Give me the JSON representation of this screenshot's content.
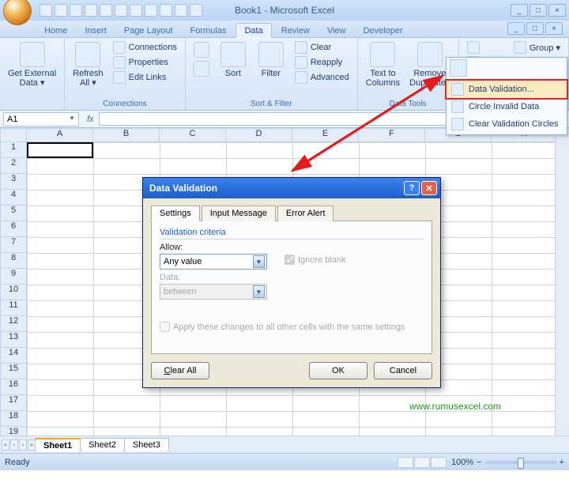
{
  "title": "Book1 - Microsoft Excel",
  "tabs": [
    "Home",
    "Insert",
    "Page Layout",
    "Formulas",
    "Data",
    "Review",
    "View",
    "Developer"
  ],
  "active_tab": "Data",
  "ribbon": {
    "get_external": "Get External\nData ▾",
    "refresh": "Refresh\nAll ▾",
    "connections": "Connections",
    "properties": "Properties",
    "editlinks": "Edit Links",
    "conn_group": "Connections",
    "sort": "Sort",
    "filter": "Filter",
    "clear": "Clear",
    "reapply": "Reapply",
    "advanced": "Advanced",
    "sf_group": "Sort & Filter",
    "ttc": "Text to\nColumns",
    "remdup": "Remove\nDuplicates",
    "dt_group": "Data Tools",
    "group": "Group ▾"
  },
  "dv_menu": {
    "validation": "Data Validation...",
    "circle": "Circle Invalid Data",
    "clear": "Clear Validation Circles"
  },
  "name_box": "A1",
  "columns": [
    "A",
    "B",
    "C",
    "D",
    "E",
    "F",
    "G",
    "H"
  ],
  "rows_count": 19,
  "sheets": [
    "Sheet1",
    "Sheet2",
    "Sheet3"
  ],
  "watermark": "www.rumusexcel.com",
  "status": "Ready",
  "zoom": "100%",
  "dialog": {
    "title": "Data Validation",
    "tabs": [
      "Settings",
      "Input Message",
      "Error Alert"
    ],
    "group": "Validation criteria",
    "allow_label": "Allow:",
    "allow_value": "Any value",
    "ignore": "Ignore blank",
    "data_label": "Data:",
    "data_value": "between",
    "apply": "Apply these changes to all other cells with the same settings",
    "clear": "Clear All",
    "ok": "OK",
    "cancel": "Cancel"
  }
}
